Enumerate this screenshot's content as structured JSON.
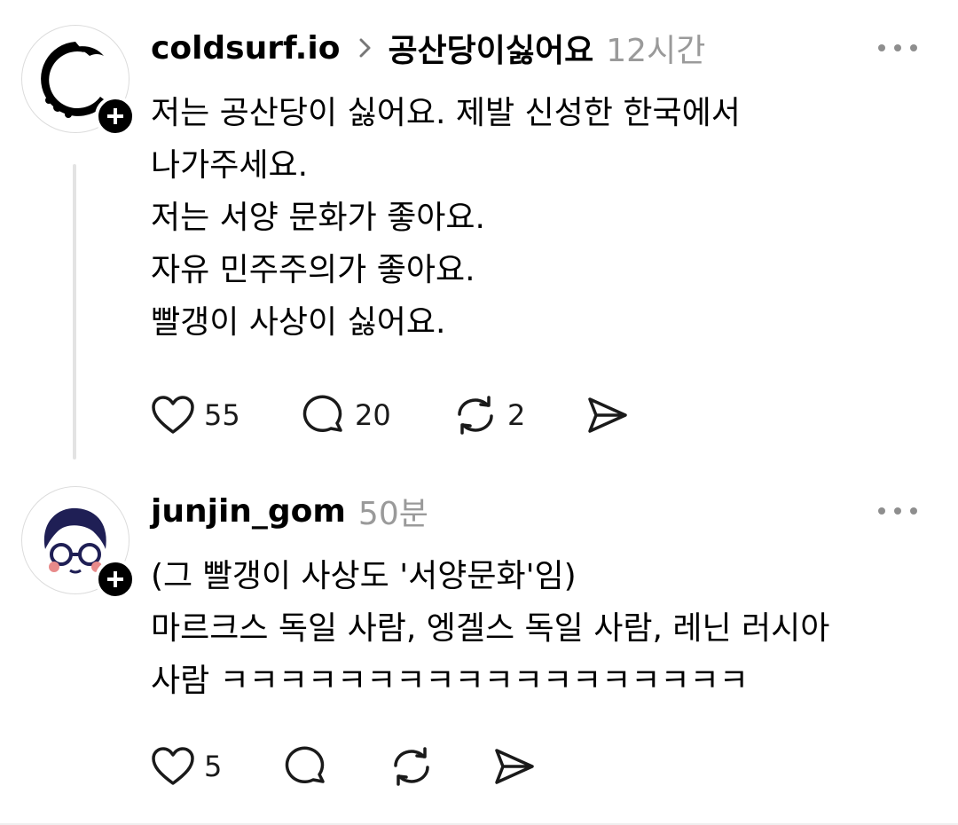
{
  "posts": [
    {
      "username": "coldsurf.io",
      "topic": "공산당이싫어요",
      "time": "12시간",
      "lines": [
        "저는 공산당이 싫어요. 제발 신성한 한국에서",
        "나가주세요.",
        "저는 서양 문화가 좋아요.",
        "자유 민주주의가 좋아요.",
        "빨갱이 사상이 싫어요."
      ],
      "likes": "55",
      "comments": "20",
      "reposts": "2"
    },
    {
      "username": "junjin_gom",
      "time": "50분",
      "lines": [
        "(그 빨갱이 사상도 '서양문화'임)",
        "마르크스 독일 사람, 엥겔스 독일 사람, 레닌 러시아",
        "사람 ㅋㅋㅋㅋㅋㅋㅋㅋㅋㅋㅋㅋㅋㅋㅋㅋㅋㅋ"
      ],
      "likes": "5"
    }
  ],
  "icons": {
    "more": "more-options-icon",
    "chevron": "chevron-right-icon",
    "like": "heart-icon",
    "comment": "comment-icon",
    "repost": "repost-icon",
    "share": "share-icon",
    "follow": "plus-icon"
  },
  "colors": {
    "text": "#000000",
    "muted": "#9a9a9a",
    "thread_line": "#e3e3e3"
  }
}
